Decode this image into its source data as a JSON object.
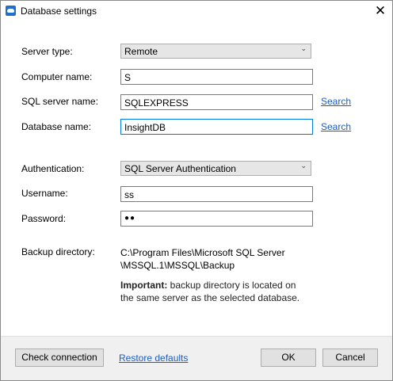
{
  "window": {
    "title": "Database settings",
    "close_glyph": "✕"
  },
  "labels": {
    "server_type": "Server type:",
    "computer_name": "Computer name:",
    "sql_server_name": "SQL server name:",
    "database_name": "Database name:",
    "authentication": "Authentication:",
    "username": "Username:",
    "password": "Password:",
    "backup_directory": "Backup directory:"
  },
  "fields": {
    "server_type": "Remote",
    "computer_name": "S",
    "sql_server_name": "SQLEXPRESS",
    "database_name": "InsightDB",
    "authentication": "SQL Server Authentication",
    "username": "ss",
    "password_mask": "●●"
  },
  "links": {
    "search_sql": "Search",
    "search_db": "Search",
    "restore_defaults": "Restore defaults"
  },
  "backup": {
    "path_line1": "C:\\Program Files\\Microsoft SQL Server",
    "path_line2": "\\MSSQL.1\\MSSQL\\Backup",
    "note_bold": "Important:",
    "note_rest": " backup directory is located on the same server as the selected database."
  },
  "buttons": {
    "check_connection": "Check connection",
    "ok": "OK",
    "cancel": "Cancel"
  },
  "icons": {
    "app": "database-app-icon",
    "chevron": "chevron-down-icon"
  },
  "colors": {
    "link": "#1a5dbf",
    "focus_border": "#0078d7",
    "app_icon": "#1f6fd1"
  }
}
